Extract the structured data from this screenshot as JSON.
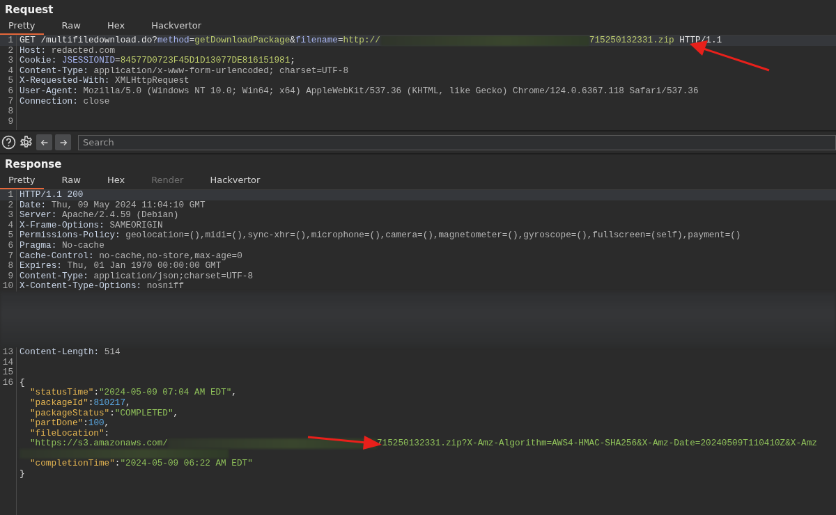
{
  "request": {
    "title": "Request",
    "tabs": [
      {
        "label": "Pretty",
        "selected": true,
        "disabled": false
      },
      {
        "label": "Raw",
        "selected": false,
        "disabled": false
      },
      {
        "label": "Hex",
        "selected": false,
        "disabled": false
      },
      {
        "label": "Hackvertor",
        "selected": false,
        "disabled": false
      }
    ],
    "lines": [
      {
        "kind": "code",
        "no": "1",
        "current": true,
        "indented": false,
        "tokens": [
          {
            "kind": "plain",
            "t": "GET /multifiledownload.do?"
          },
          {
            "kind": "param",
            "t": "method"
          },
          {
            "kind": "plain",
            "t": "="
          },
          {
            "kind": "pval",
            "t": "getDownloadPackage"
          },
          {
            "kind": "plain",
            "t": "&"
          },
          {
            "kind": "param",
            "t": "filename"
          },
          {
            "kind": "plain",
            "t": "="
          },
          {
            "kind": "pval",
            "t": "http://"
          },
          {
            "kind": "redacted"
          },
          {
            "kind": "pval",
            "t": "715250132331.zip"
          },
          {
            "kind": "plain",
            "t": " HTTP/1.1"
          }
        ]
      },
      {
        "kind": "code",
        "no": "2",
        "current": false,
        "indented": false,
        "tokens": [
          {
            "kind": "name",
            "t": "Host:"
          },
          {
            "kind": "value",
            "t": " redacted.com"
          }
        ]
      },
      {
        "kind": "code",
        "no": "3",
        "current": false,
        "indented": false,
        "tokens": [
          {
            "kind": "name",
            "t": "Cookie: "
          },
          {
            "kind": "param",
            "t": "JSESSIONID"
          },
          {
            "kind": "plain",
            "t": "="
          },
          {
            "kind": "pval",
            "t": "84577D0723F45D1D13077DE816151981"
          },
          {
            "kind": "plain",
            "t": ";"
          }
        ]
      },
      {
        "kind": "code",
        "no": "4",
        "current": false,
        "indented": false,
        "tokens": [
          {
            "kind": "name",
            "t": "Content-Type:"
          },
          {
            "kind": "value",
            "t": " application/x-www-form-urlencoded; charset=UTF-8"
          }
        ]
      },
      {
        "kind": "code",
        "no": "5",
        "current": false,
        "indented": false,
        "tokens": [
          {
            "kind": "name",
            "t": "X-Requested-With:"
          },
          {
            "kind": "value",
            "t": " XMLHttpRequest"
          }
        ]
      },
      {
        "kind": "code",
        "no": "6",
        "current": false,
        "indented": false,
        "tokens": [
          {
            "kind": "name",
            "t": "User-Agent:"
          },
          {
            "kind": "value",
            "t": " Mozilla/5.0 (Windows NT 10.0; Win64; x64) AppleWebKit/537.36 (KHTML, like Gecko) Chrome/124.0.6367.118 Safari/537.36"
          }
        ]
      },
      {
        "kind": "code",
        "no": "7",
        "current": false,
        "indented": false,
        "tokens": [
          {
            "kind": "name",
            "t": "Connection:"
          },
          {
            "kind": "value",
            "t": " close"
          }
        ]
      },
      {
        "kind": "code",
        "no": "8",
        "current": false,
        "indented": false
      },
      {
        "kind": "code",
        "no": "9",
        "current": false,
        "indented": false
      }
    ]
  },
  "toolbar": {
    "search": {
      "placeholder": "Search"
    }
  },
  "response": {
    "title": "Response",
    "tabs": [
      {
        "label": "Pretty",
        "selected": true,
        "disabled": false
      },
      {
        "label": "Raw",
        "selected": false,
        "disabled": false
      },
      {
        "label": "Hex",
        "selected": false,
        "disabled": false
      },
      {
        "label": "Render",
        "selected": false,
        "disabled": true
      },
      {
        "label": "Hackvertor",
        "selected": false,
        "disabled": false
      }
    ],
    "lines": [
      {
        "kind": "code",
        "no": "1",
        "current": true,
        "indented": false,
        "tokens": [
          {
            "kind": "name",
            "t": "HTTP/1.1 200"
          }
        ]
      },
      {
        "kind": "code",
        "no": "2",
        "current": false,
        "indented": false,
        "tokens": [
          {
            "kind": "name",
            "t": "Date:"
          },
          {
            "kind": "value",
            "t": " Thu, 09 May 2024 11:04:10 GMT"
          }
        ]
      },
      {
        "kind": "code",
        "no": "3",
        "current": false,
        "indented": false,
        "tokens": [
          {
            "kind": "name",
            "t": "Server:"
          },
          {
            "kind": "value",
            "t": " Apache/2.4.59 (Debian)"
          }
        ]
      },
      {
        "kind": "code",
        "no": "4",
        "current": false,
        "indented": false,
        "tokens": [
          {
            "kind": "name",
            "t": "X-Frame-Options:"
          },
          {
            "kind": "value",
            "t": " SAMEORIGIN"
          }
        ]
      },
      {
        "kind": "code",
        "no": "5",
        "current": false,
        "indented": false,
        "tokens": [
          {
            "kind": "name",
            "t": "Permissions-Policy:"
          },
          {
            "kind": "value",
            "t": " geolocation=(),midi=(),sync-xhr=(),microphone=(),camera=(),magnetometer=(),gyroscope=(),fullscreen=(self),payment=()"
          }
        ]
      },
      {
        "kind": "code",
        "no": "6",
        "current": false,
        "indented": false,
        "tokens": [
          {
            "kind": "name",
            "t": "Pragma:"
          },
          {
            "kind": "value",
            "t": " No-cache"
          }
        ]
      },
      {
        "kind": "code",
        "no": "7",
        "current": false,
        "indented": false,
        "tokens": [
          {
            "kind": "name",
            "t": "Cache-Control:"
          },
          {
            "kind": "value",
            "t": " no-cache,no-store,max-age=0"
          }
        ]
      },
      {
        "kind": "code",
        "no": "8",
        "current": false,
        "indented": false,
        "tokens": [
          {
            "kind": "name",
            "t": "Expires:"
          },
          {
            "kind": "value",
            "t": " Thu, 01 Jan 1970 00:00:00 GMT"
          }
        ]
      },
      {
        "kind": "code",
        "no": "9",
        "current": false,
        "indented": false,
        "tokens": [
          {
            "kind": "name",
            "t": "Content-Type:"
          },
          {
            "kind": "value",
            "t": " application/json;charset=UTF-8"
          }
        ]
      },
      {
        "kind": "code",
        "no": "10",
        "current": false,
        "indented": false,
        "tokens": [
          {
            "kind": "name",
            "t": "X-Content-Type-Options:"
          },
          {
            "kind": "value",
            "t": " nosniff"
          }
        ]
      },
      {
        "kind": "redacted-block"
      },
      {
        "kind": "code",
        "no": "13",
        "current": false,
        "indented": false,
        "tokens": [
          {
            "kind": "name",
            "t": "Content-Length:"
          },
          {
            "kind": "value",
            "t": " 514"
          }
        ]
      },
      {
        "kind": "code",
        "no": "14",
        "current": false,
        "indented": false
      },
      {
        "kind": "code",
        "no": "15",
        "current": false,
        "indented": false
      },
      {
        "kind": "code",
        "no": "16",
        "current": false,
        "indented": false,
        "tokens": [
          {
            "kind": "plain",
            "t": "{"
          }
        ]
      },
      {
        "kind": "code",
        "current": false,
        "indented": true,
        "tokens": [
          {
            "kind": "key",
            "t": "\"statusTime\""
          },
          {
            "kind": "plain",
            "t": ":"
          },
          {
            "kind": "str",
            "t": "\"2024-05-09 07:04 AM EDT\""
          },
          {
            "kind": "plain",
            "t": ","
          }
        ]
      },
      {
        "kind": "code",
        "current": false,
        "indented": true,
        "tokens": [
          {
            "kind": "key",
            "t": "\"packageId\""
          },
          {
            "kind": "plain",
            "t": ":"
          },
          {
            "kind": "num",
            "t": "810217"
          },
          {
            "kind": "plain",
            "t": ","
          }
        ]
      },
      {
        "kind": "code",
        "current": false,
        "indented": true,
        "tokens": [
          {
            "kind": "key",
            "t": "\"packageStatus\""
          },
          {
            "kind": "plain",
            "t": ":"
          },
          {
            "kind": "str",
            "t": "\"COMPLETED\""
          },
          {
            "kind": "plain",
            "t": ","
          }
        ]
      },
      {
        "kind": "code",
        "current": false,
        "indented": true,
        "tokens": [
          {
            "kind": "key",
            "t": "\"partDone\""
          },
          {
            "kind": "plain",
            "t": ":"
          },
          {
            "kind": "num",
            "t": "100"
          },
          {
            "kind": "plain",
            "t": ","
          }
        ]
      },
      {
        "kind": "code",
        "current": false,
        "indented": true,
        "tokens": [
          {
            "kind": "key",
            "t": "\"fileLocation\""
          },
          {
            "kind": "plain",
            "t": ":"
          }
        ]
      },
      {
        "kind": "code",
        "current": false,
        "indented": true,
        "tokens": [
          {
            "kind": "str",
            "t": "\"https://s3.amazonaws.com/"
          },
          {
            "kind": "redacted"
          },
          {
            "kind": "str",
            "t": "715250132331.zip?X-Amz-Algorithm=AWS4-HMAC-SHA256&X-Amz-Date=20240509T110410Z&X-Amz"
          }
        ]
      },
      {
        "kind": "code",
        "current": false,
        "indented": false,
        "tokens": [
          {
            "kind": "redacted"
          }
        ]
      },
      {
        "kind": "code",
        "current": false,
        "indented": true,
        "tokens": [
          {
            "kind": "key",
            "t": "\"completionTime\""
          },
          {
            "kind": "plain",
            "t": ":"
          },
          {
            "kind": "str",
            "t": "\"2024-05-09 06:22 AM EDT\""
          }
        ]
      },
      {
        "kind": "code",
        "current": false,
        "indented": false,
        "tokens": [
          {
            "kind": "plain",
            "t": "}"
          }
        ]
      }
    ]
  }
}
